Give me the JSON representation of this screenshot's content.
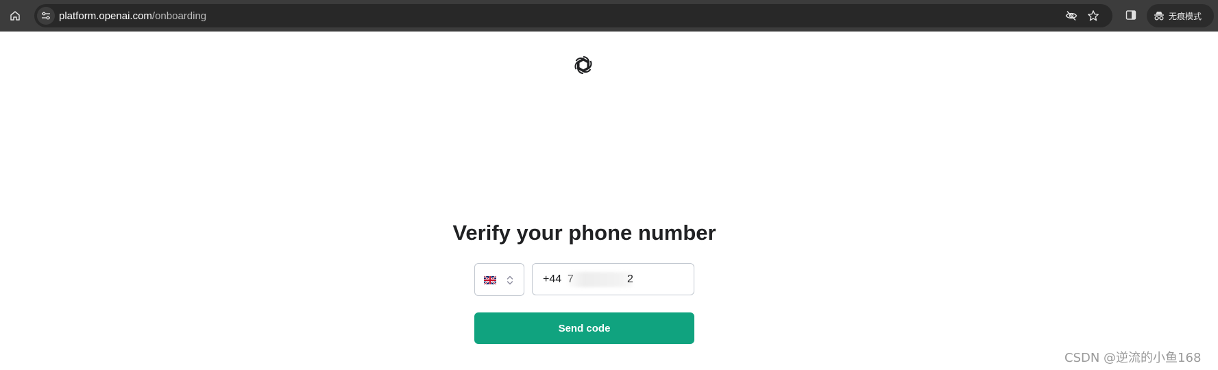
{
  "browser": {
    "url_domain": "platform.openai.com",
    "url_path": "/onboarding",
    "incognito_label": "无痕模式"
  },
  "page": {
    "title": "Verify your phone number",
    "country": "United Kingdom",
    "phone_value": "+44  7",
    "phone_tail": "2",
    "send_button": "Send code"
  },
  "watermark": "CSDN @逆流的小鱼168",
  "colors": {
    "accent": "#10a37f",
    "topbar": "#3c3c3c",
    "omnibox": "#282828",
    "title": "#202123"
  },
  "icons": {
    "home": "home-icon",
    "site_info": "tune-icon",
    "eye_off": "eye-off-icon",
    "bookmark": "star-icon",
    "side_panel": "side-panel-icon",
    "incognito": "incognito-icon",
    "logo": "openai-logo",
    "chevron": "chevron-up-down-icon",
    "flag": "uk-flag-icon"
  }
}
